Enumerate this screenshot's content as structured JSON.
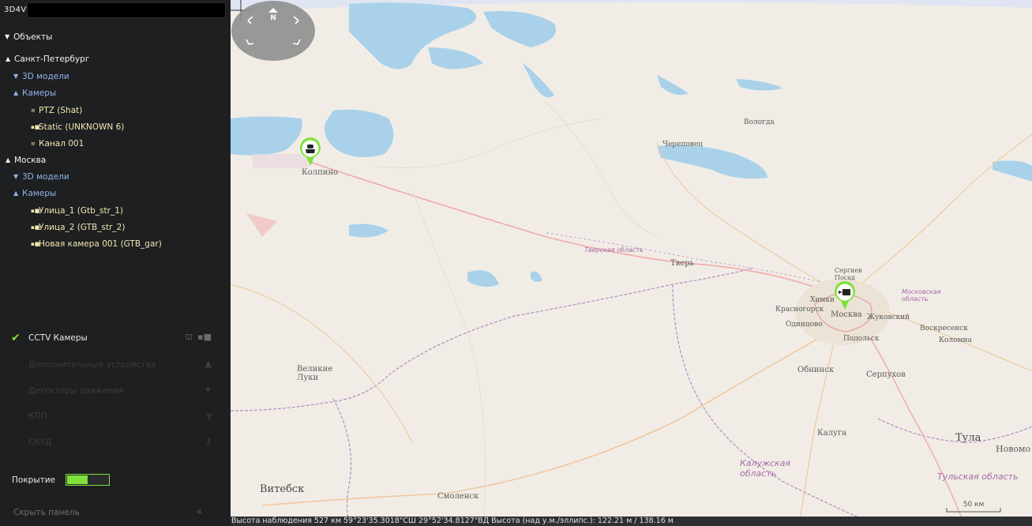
{
  "app": {
    "name": "3D4V",
    "search_value": ""
  },
  "tree": {
    "root_label": "Объекты",
    "cities": [
      {
        "name": "Санкт-Петербург",
        "models_label": "3D модели",
        "cameras_label": "Камеры",
        "cameras": [
          "PTZ (Shat)",
          "Static (UNKNOWN 6)",
          "Канал 001"
        ]
      },
      {
        "name": "Москва",
        "models_label": "3D модели",
        "cameras_label": "Камеры",
        "cameras": [
          "Улица_1 (Gtb_str_1)",
          "Улица_2 (GTB_str_2)",
          "Новая камера 001 (GTB_gar)"
        ]
      }
    ]
  },
  "layers": [
    {
      "label": "CCTV Камеры",
      "checked": true
    },
    {
      "label": "Дополнительные устройства",
      "checked": false
    },
    {
      "label": "Детекторы движения",
      "checked": false
    },
    {
      "label": "КПП",
      "checked": false
    },
    {
      "label": "СКУД",
      "checked": false
    }
  ],
  "coverage": {
    "label": "Покрытие",
    "level": 0.5
  },
  "hide_panel_label": "Скрыть панель",
  "compass": {
    "north": "N"
  },
  "scale_label": "50 км",
  "status": "Высота наблюдения 527 км      59°23'35.3018\"СШ 29°52'34.8127\"ВД   Высота (над у.м./эллипс.): 122.21 м / 138.16 м",
  "map_labels": {
    "kolpino": "Колпино",
    "tver": "Тверь",
    "moskva": "Москва",
    "velikie_luki": "Великие\nЛуки",
    "vitebsk": "Витебск",
    "smolensk": "Смоленск",
    "kaluga": "Калуга",
    "tula": "Тула",
    "obninsk": "Обнинск",
    "serpukhov": "Серпухов",
    "podolsk": "Подольск",
    "odintsovo": "Одинцово",
    "krasnogorsk": "Красногорск",
    "khimki": "Химки",
    "zhukovsky": "Жуковский",
    "voskresensk": "Воскресенск",
    "kolomna": "Коломна",
    "sergiev_posad": "Сергиев\nПосад",
    "cherepovets": "Череповец",
    "vologda": "Вологда",
    "novomoskovsk": "Новомо",
    "tver_oblast": "Тверская область",
    "moskovskaya_oblast": "Московская\nобласть",
    "kaluzhskaya_oblast": "Калужская\nобласть",
    "tulskaya_oblast": "Тульская область"
  },
  "colors": {
    "accent": "#7fe13c",
    "water": "#a9d1ea",
    "panel": "#1e1f21"
  }
}
